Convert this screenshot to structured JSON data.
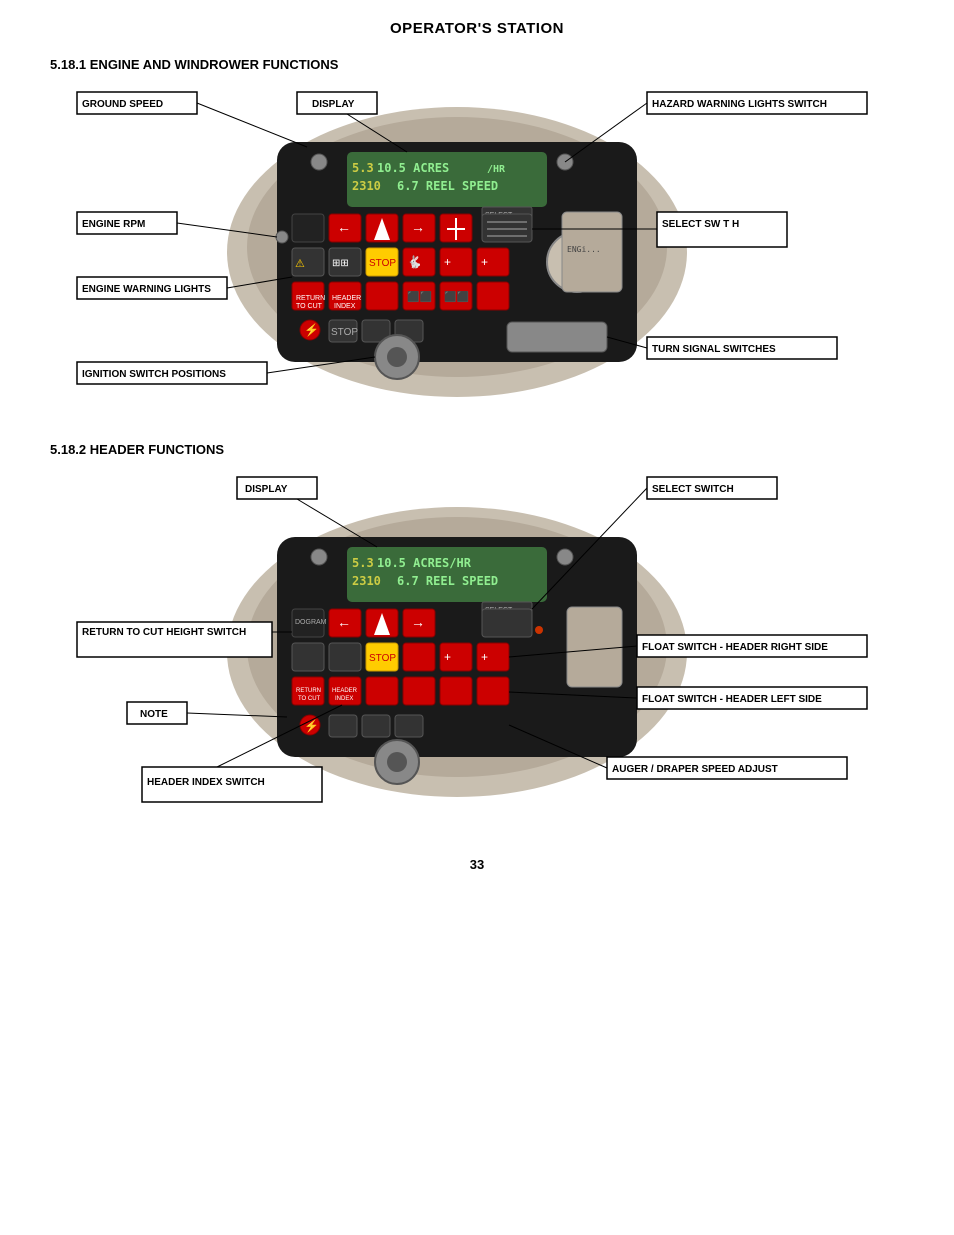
{
  "page": {
    "title": "OPERATOR'S STATION",
    "page_number": "33"
  },
  "section1": {
    "title": "5.18.1  ENGINE AND WINDROWER FUNCTIONS",
    "display_line1": "5.3  10.5 ACRES/HR",
    "display_line2": "2310  6.7 REEL SPEED",
    "callouts": [
      {
        "id": "ground-speed",
        "label": "GROUND SPEED"
      },
      {
        "id": "display1",
        "label": "DISPLAY"
      },
      {
        "id": "hazard-warning",
        "label": "HAZARD WARNING LIGHTS SWITCH"
      },
      {
        "id": "engine-rpm",
        "label": "ENGINE RPM"
      },
      {
        "id": "select-switch1",
        "label": "SELECT SW T   H"
      },
      {
        "id": "engine-warning",
        "label": "ENGINE WARNING LIGHTS"
      },
      {
        "id": "ignition-switch",
        "label": "IGNITION SWITCH POSITIONS"
      },
      {
        "id": "turn-signal",
        "label": "TURN SIGNAL SWITCHES"
      }
    ]
  },
  "section2": {
    "title": "5.18.2  HEADER FUNCTIONS",
    "display_line1": "5.3  10.5 ACRES/HR",
    "display_line2": "2310  6.7 REEL SPEED",
    "callouts": [
      {
        "id": "display2",
        "label": "DISPLAY"
      },
      {
        "id": "select-switch2",
        "label": "SELECT SWITCH"
      },
      {
        "id": "return-to-cut",
        "label": "RETURN TO CUT HEIGHT SWITCH"
      },
      {
        "id": "float-right",
        "label": "FLOAT SWITCH - HEADER RIGHT SIDE"
      },
      {
        "id": "note",
        "label": "NOTE"
      },
      {
        "id": "float-left",
        "label": "FLOAT SWITCH - HEADER LEFT SIDE"
      },
      {
        "id": "header-index",
        "label": "HEADER INDEX SWITCH"
      },
      {
        "id": "auger-draper",
        "label": "AUGER / DRAPER SPEED ADJUST"
      }
    ]
  }
}
